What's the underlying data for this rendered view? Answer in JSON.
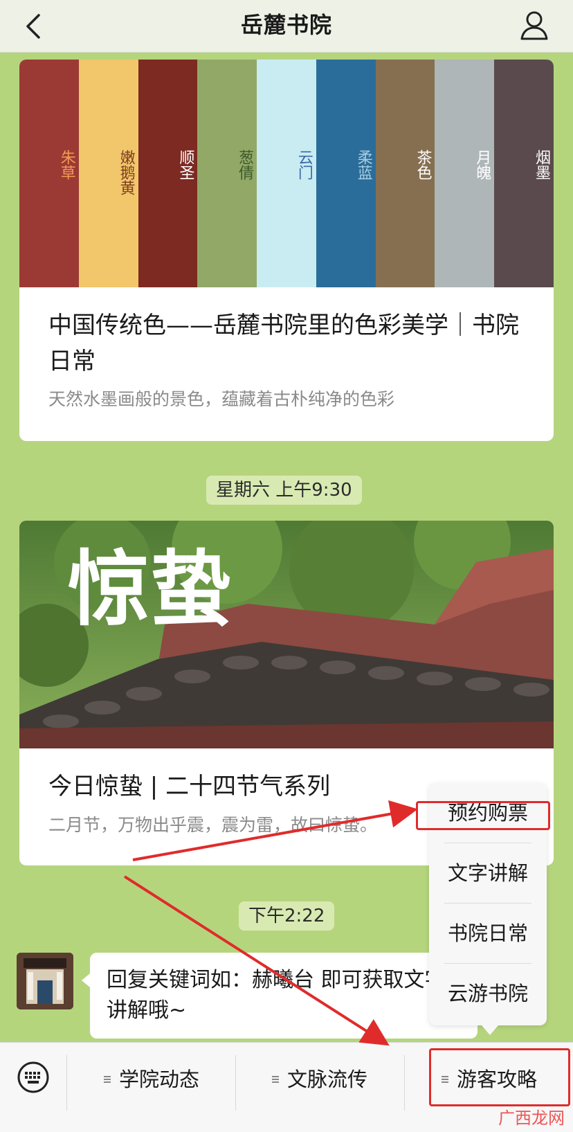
{
  "header": {
    "title": "岳麓书院"
  },
  "card1": {
    "stripes": [
      {
        "label": "朱草",
        "bg": "#9b3a34",
        "fg": "#f39a55"
      },
      {
        "label": "嫩鹅黄",
        "bg": "#f2c66b",
        "fg": "#7d3e1e"
      },
      {
        "label": "顺圣",
        "bg": "#7c2a22",
        "fg": "#ffffff"
      },
      {
        "label": "葱倩",
        "bg": "#92a867",
        "fg": "#3d5a2a"
      },
      {
        "label": "云门",
        "bg": "#c9ecf3",
        "fg": "#3b69a6"
      },
      {
        "label": "柔蓝",
        "bg": "#2a6d9a",
        "fg": "#a9cde0"
      },
      {
        "label": "茶色",
        "bg": "#866f51",
        "fg": "#ffffff"
      },
      {
        "label": "月魄",
        "bg": "#aeb6b7",
        "fg": "#ffffff"
      },
      {
        "label": "烟墨",
        "bg": "#5a4a4e",
        "fg": "#ffffff"
      }
    ],
    "title": "中国传统色——岳麓书院里的色彩美学｜书院日常",
    "subtitle": "天然水墨画般的景色，蕴藏着古朴纯净的色彩"
  },
  "time1": "星期六 上午9:30",
  "card2": {
    "image_text": "惊蛰",
    "title": "今日惊蛰 | 二十四节气系列",
    "subtitle": "二月节，万物出乎震，震为雷，故曰惊蛰。"
  },
  "time2": "下午2:22",
  "message": {
    "text": "回复关键词如：赫曦台 即可获取文字讲解哦~"
  },
  "popup": {
    "items": [
      "预约购票",
      "文字讲解",
      "书院日常",
      "云游书院"
    ]
  },
  "bottombar": {
    "menus": [
      "学院动态",
      "文脉流传",
      "游客攻略"
    ]
  },
  "watermark": "广西龙网",
  "colors": {
    "background": "#b5d57d",
    "annotation": "#e02b2b"
  }
}
